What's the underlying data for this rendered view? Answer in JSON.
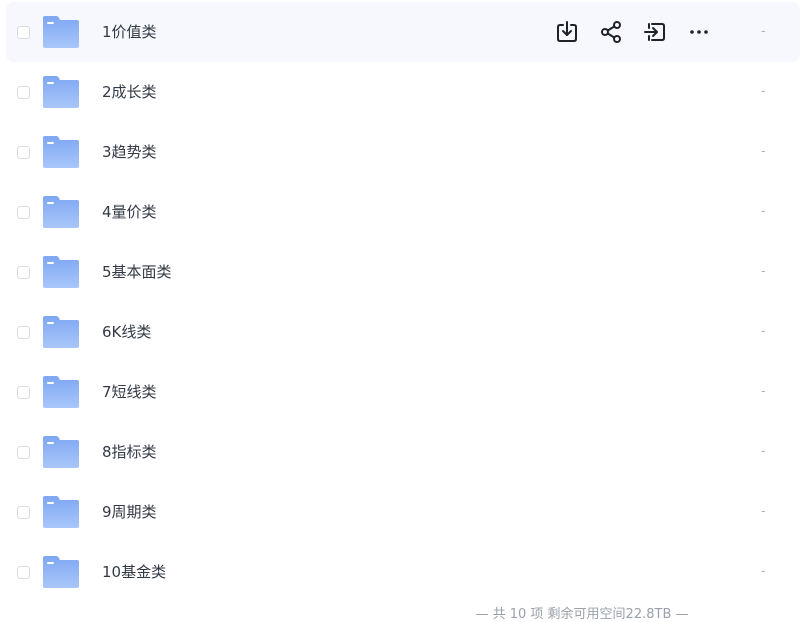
{
  "files": [
    {
      "name": "1价值类",
      "size": "-"
    },
    {
      "name": "2成长类",
      "size": "-"
    },
    {
      "name": "3趋势类",
      "size": "-"
    },
    {
      "name": "4量价类",
      "size": "-"
    },
    {
      "name": "5基本面类",
      "size": "-"
    },
    {
      "name": "6K线类",
      "size": "-"
    },
    {
      "name": "7短线类",
      "size": "-"
    },
    {
      "name": "8指标类",
      "size": "-"
    },
    {
      "name": "9周期类",
      "size": "-"
    },
    {
      "name": "10基金类",
      "size": "-"
    }
  ],
  "row_actions": [
    "download-icon",
    "share-icon",
    "move-to-icon",
    "more-icon"
  ],
  "folder_color": "#8fb4f6",
  "hover_row_background": "#f6f8fd",
  "footer": {
    "text": "— 共 10 项 剩余可用空间22.8TB —"
  }
}
